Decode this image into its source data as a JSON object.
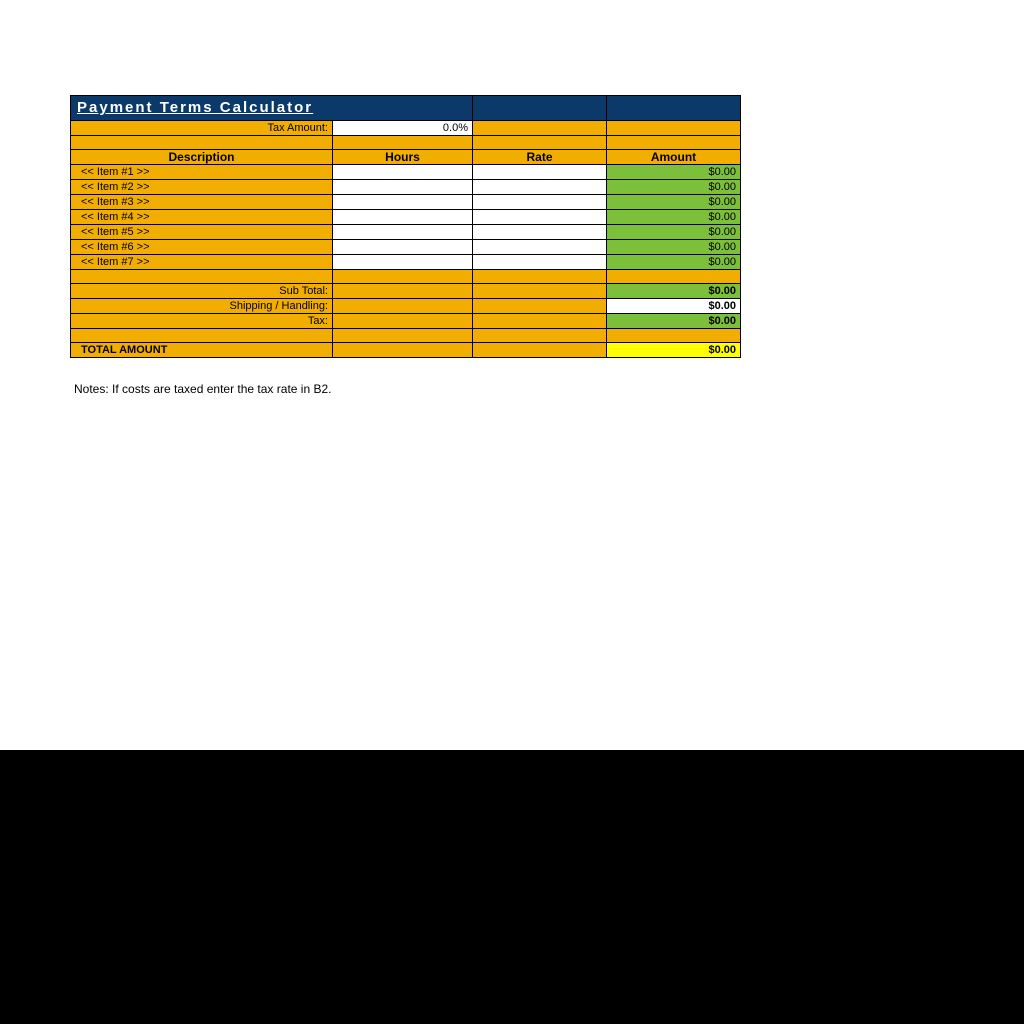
{
  "title": "Payment Terms Calculator",
  "tax_label": "Tax Amount:",
  "tax_value": "0.0%",
  "headers": {
    "description": "Description",
    "hours": "Hours",
    "rate": "Rate",
    "amount": "Amount"
  },
  "items": [
    {
      "desc": "<< Item #1 >>",
      "amount": "$0.00"
    },
    {
      "desc": "<< Item #2 >>",
      "amount": "$0.00"
    },
    {
      "desc": "<< Item #3 >>",
      "amount": "$0.00"
    },
    {
      "desc": "<< Item #4 >>",
      "amount": "$0.00"
    },
    {
      "desc": "<< Item #5 >>",
      "amount": "$0.00"
    },
    {
      "desc": "<< Item #6 >>",
      "amount": "$0.00"
    },
    {
      "desc": "<< Item #7 >>",
      "amount": "$0.00"
    }
  ],
  "subtotal_label": "Sub Total:",
  "subtotal_value": "$0.00",
  "shipping_label": "Shipping / Handling:",
  "shipping_value": "$0.00",
  "tax_row_label": "Tax:",
  "tax_row_value": "$0.00",
  "total_label": "TOTAL AMOUNT",
  "total_value": "$0.00",
  "notes": "Notes: If costs are taxed enter the tax rate in B2."
}
